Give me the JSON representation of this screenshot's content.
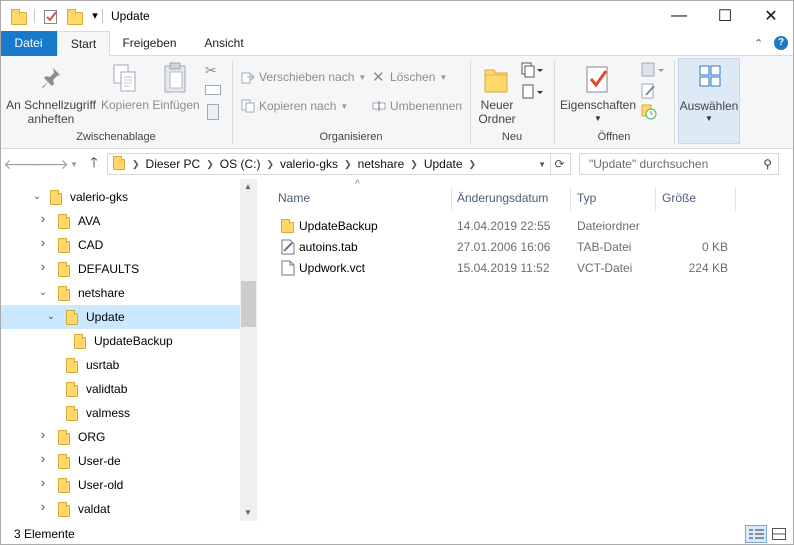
{
  "window": {
    "title": "Update",
    "minimize_glyph": "—",
    "maximize_glyph": "☐",
    "close_glyph": "✕",
    "qat_dropdown_glyph": "▾"
  },
  "tabs": [
    {
      "label": "Datei"
    },
    {
      "label": "Start"
    },
    {
      "label": "Freigeben"
    },
    {
      "label": "Ansicht"
    }
  ],
  "ribbon": {
    "pin_label_1": "An Schnellzugriff",
    "pin_label_2": "anheften",
    "copy_label": "Kopieren",
    "paste_label": "Einfügen",
    "group_clipboard": "Zwischenablage",
    "move_label": "Verschieben nach",
    "copy_to_label": "Kopieren nach",
    "delete_label": "Löschen",
    "rename_label": "Umbenennen",
    "group_organize": "Organisieren",
    "new_folder_label_1": "Neuer",
    "new_folder_label_2": "Ordner",
    "group_new": "Neu",
    "properties_label": "Eigenschaften",
    "group_open": "Öffnen",
    "select_label": "Auswählen",
    "help_glyph": "?",
    "collapse_glyph": "⌃"
  },
  "address": {
    "crumbs": [
      "Dieser PC",
      "OS (C:)",
      "valerio-gks",
      "netshare",
      "Update"
    ],
    "search_placeholder": "\"Update\" durchsuchen"
  },
  "nav_tree": [
    {
      "label": "valerio-gks",
      "chevron": "expanded"
    },
    {
      "label": "AVA",
      "chevron": "collapsed"
    },
    {
      "label": "CAD",
      "chevron": "collapsed"
    },
    {
      "label": "DEFAULTS",
      "chevron": "collapsed"
    },
    {
      "label": "netshare",
      "chevron": "expanded"
    },
    {
      "label": "Update",
      "chevron": "expanded",
      "selected": true
    },
    {
      "label": "UpdateBackup",
      "chevron": "none"
    },
    {
      "label": "usrtab",
      "chevron": "none"
    },
    {
      "label": "validtab",
      "chevron": "none"
    },
    {
      "label": "valmess",
      "chevron": "none"
    },
    {
      "label": "ORG",
      "chevron": "collapsed"
    },
    {
      "label": "User-de",
      "chevron": "collapsed"
    },
    {
      "label": "User-old",
      "chevron": "collapsed"
    },
    {
      "label": "valdat",
      "chevron": "collapsed"
    }
  ],
  "columns": {
    "name": "Name",
    "date": "Änderungsdatum",
    "type": "Typ",
    "size": "Größe"
  },
  "files": [
    {
      "name": "UpdateBackup",
      "date": "14.04.2019 22:55",
      "type": "Dateiordner",
      "size": "",
      "icon": "folder"
    },
    {
      "name": "autoins.tab",
      "date": "27.01.2006 16:06",
      "type": "TAB-Datei",
      "size": "0 KB",
      "icon": "tab-file"
    },
    {
      "name": "Updwork.vct",
      "date": "15.04.2019 11:52",
      "type": "VCT-Datei",
      "size": "224 KB",
      "icon": "blank-file"
    }
  ],
  "status": {
    "count": "3 Elemente"
  }
}
